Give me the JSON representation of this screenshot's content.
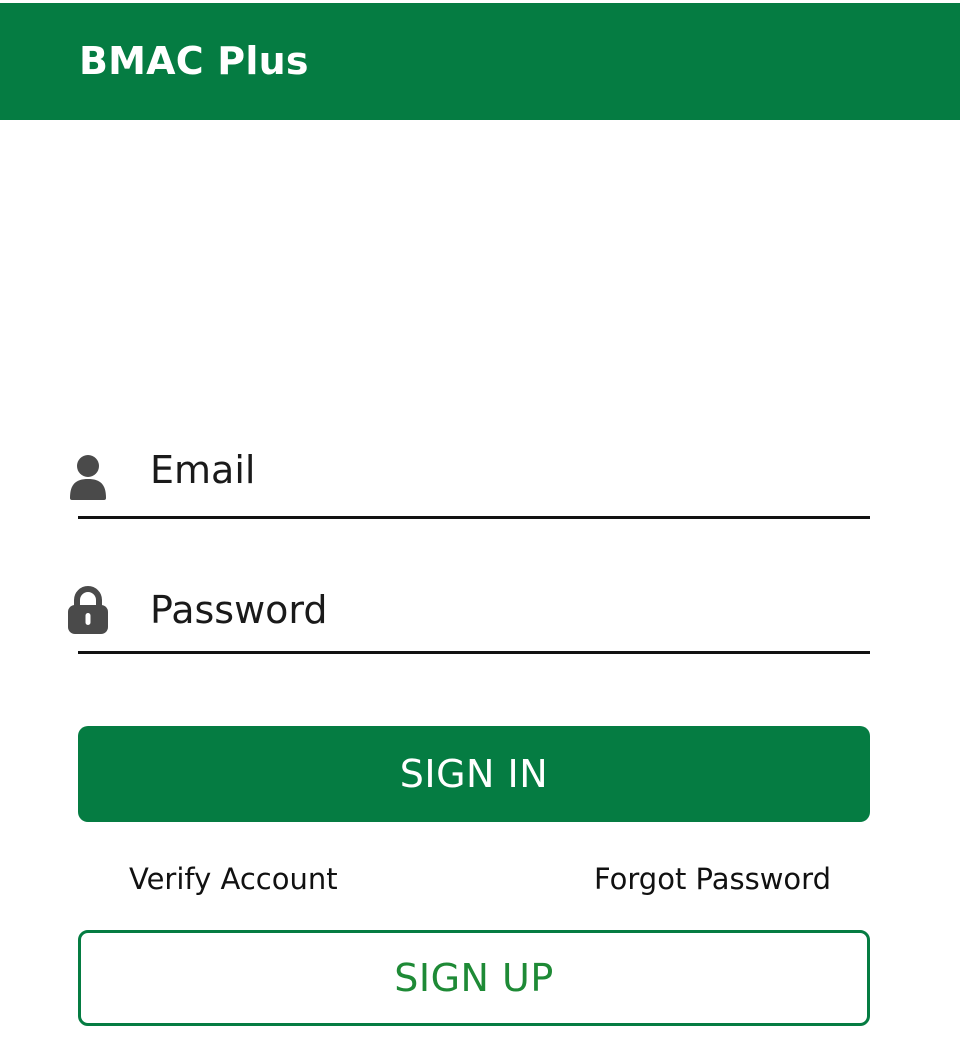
{
  "app_bar": {
    "title": "BMAC Plus",
    "color": "#057c42"
  },
  "login_form": {
    "email": {
      "icon": "person-icon",
      "value": "",
      "placeholder": "Email"
    },
    "password": {
      "icon": "lock-icon",
      "value": "",
      "placeholder": "Password"
    },
    "sign_in_label": "SIGN IN",
    "verify_account_label": "Verify Account",
    "forgot_password_label": "Forgot Password",
    "sign_up_label": "SIGN UP"
  },
  "colors": {
    "primary": "#057c42",
    "sign_up_text": "#1e8a36",
    "text": "#111111",
    "icon": "#4a4a4a"
  }
}
